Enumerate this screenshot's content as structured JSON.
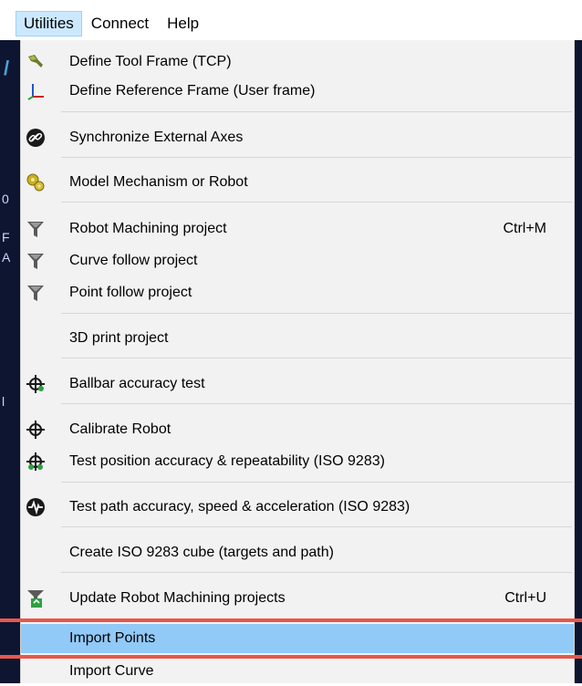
{
  "menubar": {
    "items": [
      "Utilities",
      "Connect",
      "Help"
    ]
  },
  "background": {
    "fragments": [
      "0",
      "F",
      "A",
      "l"
    ]
  },
  "menu": {
    "items": [
      {
        "label": "Define Tool Frame (TCP)",
        "icon": "tool-frame-icon",
        "shortcut": ""
      },
      {
        "label": "Define Reference Frame (User frame)",
        "icon": "reference-frame-icon",
        "shortcut": ""
      },
      {
        "label": "Synchronize External Axes",
        "icon": "link-icon",
        "shortcut": ""
      },
      {
        "label": "Model Mechanism or Robot",
        "icon": "gears-icon",
        "shortcut": ""
      },
      {
        "label": "Robot Machining project",
        "icon": "funnel-icon",
        "shortcut": "Ctrl+M"
      },
      {
        "label": "Curve follow project",
        "icon": "funnel-icon",
        "shortcut": ""
      },
      {
        "label": "Point follow project",
        "icon": "funnel-icon",
        "shortcut": ""
      },
      {
        "label": "3D print project",
        "icon": "",
        "shortcut": ""
      },
      {
        "label": "Ballbar accuracy test",
        "icon": "crosshair-green-icon",
        "shortcut": ""
      },
      {
        "label": "Calibrate Robot",
        "icon": "crosshair-icon",
        "shortcut": ""
      },
      {
        "label": "Test position accuracy & repeatability (ISO 9283)",
        "icon": "crosshair-green-icon",
        "shortcut": ""
      },
      {
        "label": "Test path accuracy, speed & acceleration (ISO 9283)",
        "icon": "waveform-icon",
        "shortcut": ""
      },
      {
        "label": "Create ISO 9283 cube (targets and path)",
        "icon": "",
        "shortcut": ""
      },
      {
        "label": "Update Robot Machining projects",
        "icon": "update-machining-icon",
        "shortcut": "Ctrl+U"
      },
      {
        "label": "Import Points",
        "icon": "",
        "shortcut": ""
      },
      {
        "label": "Import Curve",
        "icon": "",
        "shortcut": ""
      }
    ],
    "selected_label": "Import Points"
  },
  "colors": {
    "selected": "#91c9f7",
    "highlight_border": "#e8574b",
    "menu_bg": "#f2f2f2"
  }
}
